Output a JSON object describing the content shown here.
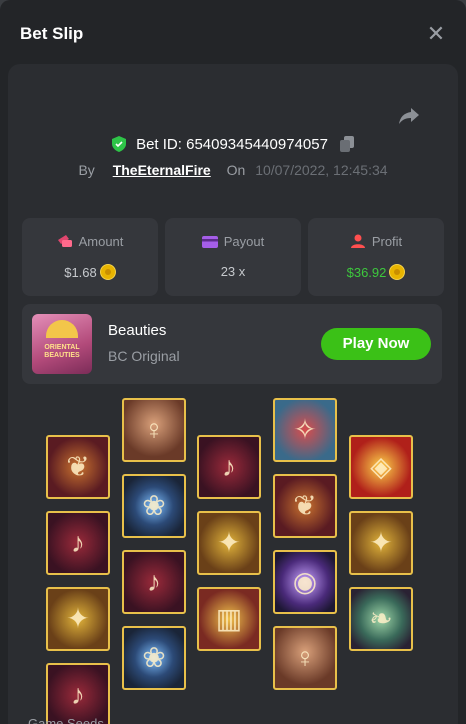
{
  "modal": {
    "title": "Bet Slip",
    "close_icon": "close-icon"
  },
  "bet": {
    "id_label": "Bet ID: 65409345440974057",
    "by_label": "By",
    "username": "TheEternalFire",
    "on_label": "On",
    "datetime": "10/07/2022, 12:45:34"
  },
  "stats": {
    "amount": {
      "label": "Amount",
      "value": "$1.68",
      "icon": "amount-icon"
    },
    "payout": {
      "label": "Payout",
      "value": "23 x",
      "icon": "payout-icon"
    },
    "profit": {
      "label": "Profit",
      "value": "$36.92",
      "icon": "profit-icon"
    }
  },
  "game": {
    "name": "Beauties",
    "provider": "BC Original",
    "thumb_text": "ORIENTAL BEAUTIES",
    "play_label": "Play Now"
  },
  "colors": {
    "accent_green": "#3bc117",
    "profit_green": "#3dc83d",
    "tile_border": "#e8c04a",
    "panel_bg": "#2b2d31"
  },
  "reels": [
    [
      "scroll",
      "pipa",
      "hairpin",
      "pipa"
    ],
    [
      "lady",
      "lotus",
      "pipa",
      "lotus"
    ],
    [
      "pipa",
      "hairpin",
      "comb"
    ],
    [
      "fan",
      "scroll",
      "ring",
      "lady"
    ],
    [
      "gold",
      "hairpin",
      "jade"
    ]
  ],
  "footer_partial": "Game Seeds"
}
